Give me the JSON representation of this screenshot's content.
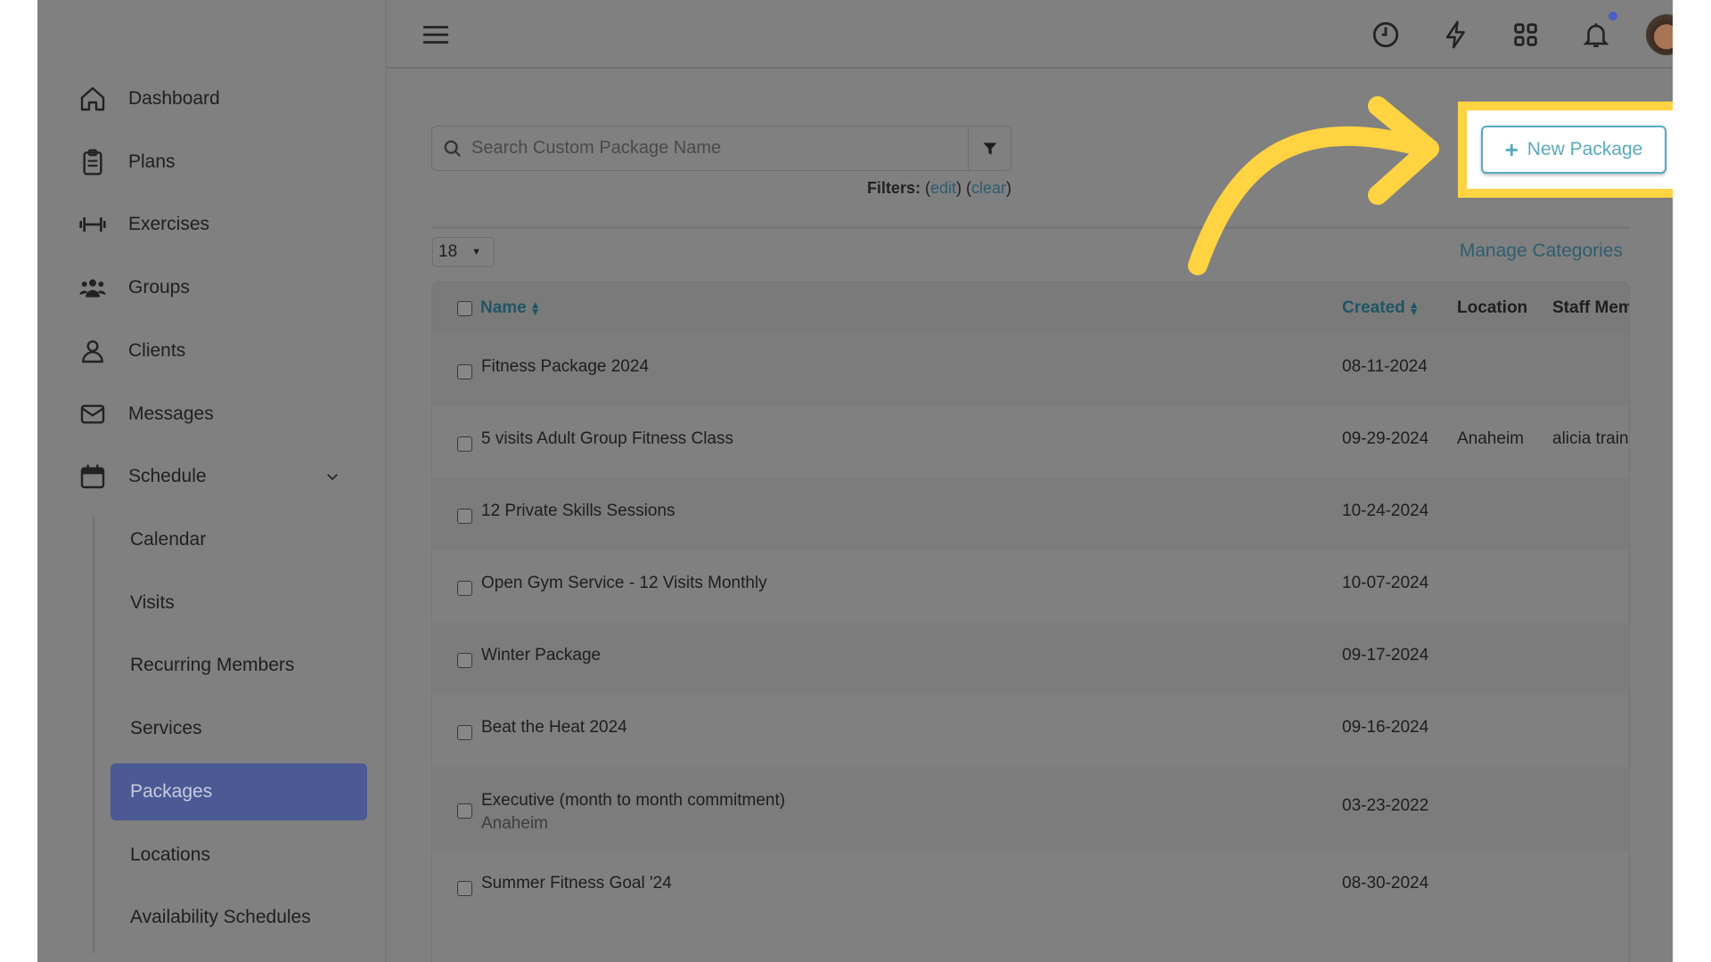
{
  "sidebar": {
    "items": [
      {
        "label": "Dashboard",
        "icon": "home-icon"
      },
      {
        "label": "Plans",
        "icon": "clipboard-icon"
      },
      {
        "label": "Exercises",
        "icon": "dumbbell-icon"
      },
      {
        "label": "Groups",
        "icon": "users-icon"
      },
      {
        "label": "Clients",
        "icon": "user-icon"
      },
      {
        "label": "Messages",
        "icon": "envelope-icon"
      },
      {
        "label": "Schedule",
        "icon": "calendar-icon"
      }
    ],
    "schedule_sub": [
      {
        "label": "Calendar"
      },
      {
        "label": "Visits"
      },
      {
        "label": "Recurring Members"
      },
      {
        "label": "Services"
      },
      {
        "label": "Packages",
        "active": true
      },
      {
        "label": "Locations"
      },
      {
        "label": "Availability Schedules"
      }
    ]
  },
  "topbar": {
    "icons": [
      "menu-icon",
      "history-icon",
      "bolt-icon",
      "apps-grid-icon",
      "bell-icon",
      "avatar"
    ],
    "notification_dot_color": "#4b5fc4"
  },
  "search": {
    "placeholder": "Search Custom Package Name"
  },
  "filters": {
    "label": "Filters:",
    "edit": "edit",
    "clear": "clear"
  },
  "page_size": "18",
  "manage_categories": "Manage Categories",
  "new_package": {
    "label": "New Package",
    "highlight_color": "#ffd341",
    "accent": "#5aa8bf"
  },
  "table": {
    "headers": {
      "name": "Name",
      "created": "Created",
      "location": "Location",
      "staff": "Staff Mem"
    },
    "rows": [
      {
        "name": "Fitness Package 2024",
        "created": "08-11-2024",
        "location": "",
        "staff": ""
      },
      {
        "name": "5 visits Adult Group Fitness Class",
        "created": "09-29-2024",
        "location": "Anaheim",
        "staff": "alicia traine"
      },
      {
        "name": "12 Private Skills Sessions",
        "created": "10-24-2024",
        "location": "",
        "staff": ""
      },
      {
        "name": "Open Gym Service - 12 Visits Monthly",
        "created": "10-07-2024",
        "location": "",
        "staff": ""
      },
      {
        "name": "Winter Package",
        "created": "09-17-2024",
        "location": "",
        "staff": ""
      },
      {
        "name": "Beat the Heat 2024",
        "created": "09-16-2024",
        "location": "",
        "staff": ""
      },
      {
        "name": "Executive (month to month commitment)",
        "sub": "Anaheim",
        "created": "03-23-2022",
        "location": "",
        "staff": ""
      },
      {
        "name": "Summer Fitness Goal '24",
        "created": "08-30-2024",
        "location": "",
        "staff": ""
      }
    ]
  }
}
